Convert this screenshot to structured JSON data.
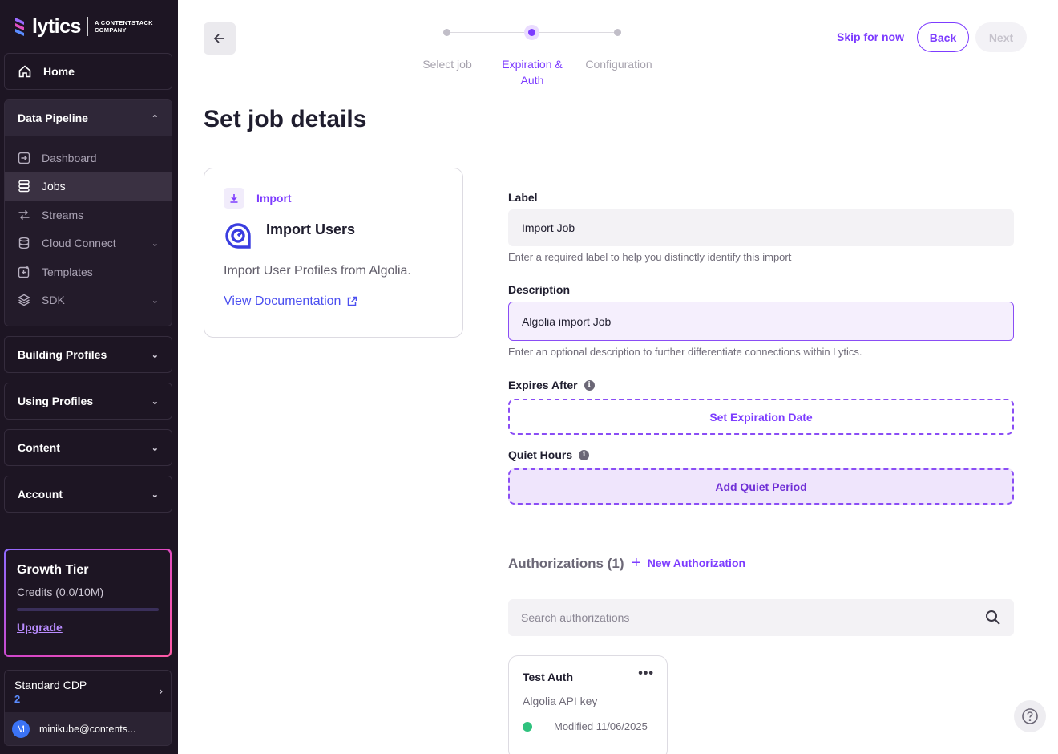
{
  "brand": {
    "logo_text": "lytics",
    "tagline_line1": "A CONTENTSTACK",
    "tagline_line2": "COMPANY"
  },
  "sidebar": {
    "home": "Home",
    "data_pipeline": {
      "title": "Data Pipeline",
      "items": [
        {
          "label": "Dashboard",
          "icon": "arrow-in-box-icon",
          "active": false,
          "expandable": false
        },
        {
          "label": "Jobs",
          "icon": "stack-icon",
          "active": true,
          "expandable": false
        },
        {
          "label": "Streams",
          "icon": "streams-icon",
          "active": false,
          "expandable": false
        },
        {
          "label": "Cloud Connect",
          "icon": "database-icon",
          "active": false,
          "expandable": true
        },
        {
          "label": "Templates",
          "icon": "template-icon",
          "active": false,
          "expandable": false
        },
        {
          "label": "SDK",
          "icon": "sdk-icon",
          "active": false,
          "expandable": true
        }
      ]
    },
    "sections": [
      {
        "label": "Building Profiles"
      },
      {
        "label": "Using Profiles"
      },
      {
        "label": "Content"
      },
      {
        "label": "Account"
      }
    ],
    "growth": {
      "title": "Growth Tier",
      "credits": "Credits (0.0/10M)",
      "credits_used_fraction": 0.0,
      "upgrade": "Upgrade"
    },
    "account": {
      "name": "Standard CDP",
      "number": "2",
      "avatar_initial": "M",
      "email": "minikube@contents..."
    }
  },
  "stepper": {
    "steps": [
      {
        "label": "Select job",
        "state": "done"
      },
      {
        "label": "Expiration &",
        "label2": "Auth",
        "state": "active"
      },
      {
        "label": "Configuration",
        "state": "pending"
      }
    ]
  },
  "header": {
    "skip": "Skip for now",
    "back": "Back",
    "next": "Next"
  },
  "page": {
    "title": "Set job details"
  },
  "job_card": {
    "type": "Import",
    "title": "Import Users",
    "description": "Import User Profiles from Algolia.",
    "doc_link": "View Documentation"
  },
  "form": {
    "label": {
      "title": "Label",
      "value": "Import Job",
      "help": "Enter a required label to help you distinctly identify this import"
    },
    "description": {
      "title": "Description",
      "value": "Algolia import Job",
      "help": "Enter an optional description to further differentiate connections within Lytics."
    },
    "expires": {
      "title": "Expires After",
      "button": "Set Expiration Date"
    },
    "quiet_hours": {
      "title": "Quiet Hours",
      "button": "Add Quiet Period"
    }
  },
  "authorizations": {
    "heading": "Authorizations (1)",
    "new_button": "New Authorization",
    "search_placeholder": "Search authorizations",
    "items": [
      {
        "name": "Test Auth",
        "type": "Algolia API key",
        "modified": "Modified 11/06/2025",
        "status_color": "#2fc27e"
      }
    ]
  },
  "colors": {
    "accent": "#7d3cff",
    "sidebar_bg": "#1d1523",
    "link_blue": "#4b4ff0"
  }
}
